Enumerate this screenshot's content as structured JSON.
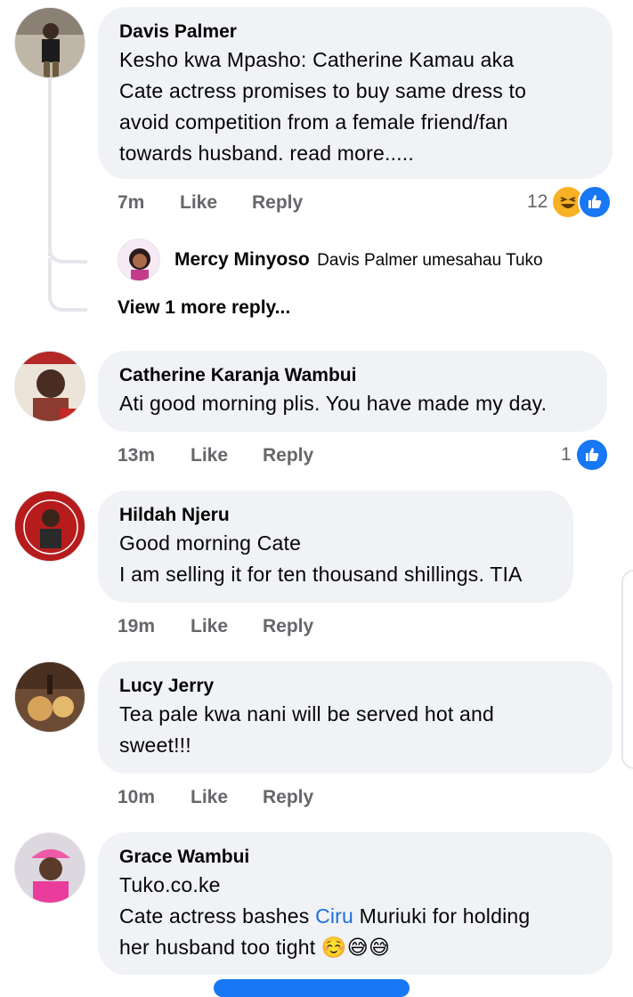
{
  "comments": [
    {
      "name": "Davis Palmer",
      "lines": [
        "Kesho kwa Mpasho: Catherine Kamau aka",
        "Cate actress promises to buy same dress to",
        "avoid competition from a female friend/fan",
        "towards husband. read more....."
      ],
      "time": "7m",
      "like": "Like",
      "reply": "Reply",
      "reaction_count": "12",
      "reactions": [
        "haha-icon",
        "like-icon"
      ]
    },
    {
      "name": "Catherine Karanja Wambui",
      "lines": [
        "Ati good morning plis. You have made my day."
      ],
      "time": "13m",
      "like": "Like",
      "reply": "Reply",
      "reaction_count": "1",
      "reactions": [
        "like-icon"
      ]
    },
    {
      "name": "Hildah Njeru",
      "lines": [
        "Good morning Cate",
        "I am selling it for ten thousand shillings. TIA"
      ],
      "time": "19m",
      "like": "Like",
      "reply": "Reply"
    },
    {
      "name": "Lucy Jerry",
      "lines": [
        "Tea pale kwa nani will be served hot and",
        "sweet!!!"
      ],
      "time": "10m",
      "like": "Like",
      "reply": "Reply"
    },
    {
      "name": "Grace Wambui",
      "link": "Tuko.co.ke",
      "line1_pre": "Cate actress bashes ",
      "line1_link": "Ciru",
      "line1_post": " Muriuki for holding",
      "line2": "her husband too tight",
      "emojis": [
        "☺️",
        "😅",
        "😅"
      ]
    }
  ],
  "reply": {
    "name": "Mercy Minyoso",
    "text": "Davis Palmer umesahau Tuko"
  },
  "view_more": "View 1 more reply...",
  "colors": {
    "bubble": "#f0f2f5",
    "meta": "#65676b",
    "link": "#1d6fd8",
    "like_blue": "#1877f2"
  }
}
